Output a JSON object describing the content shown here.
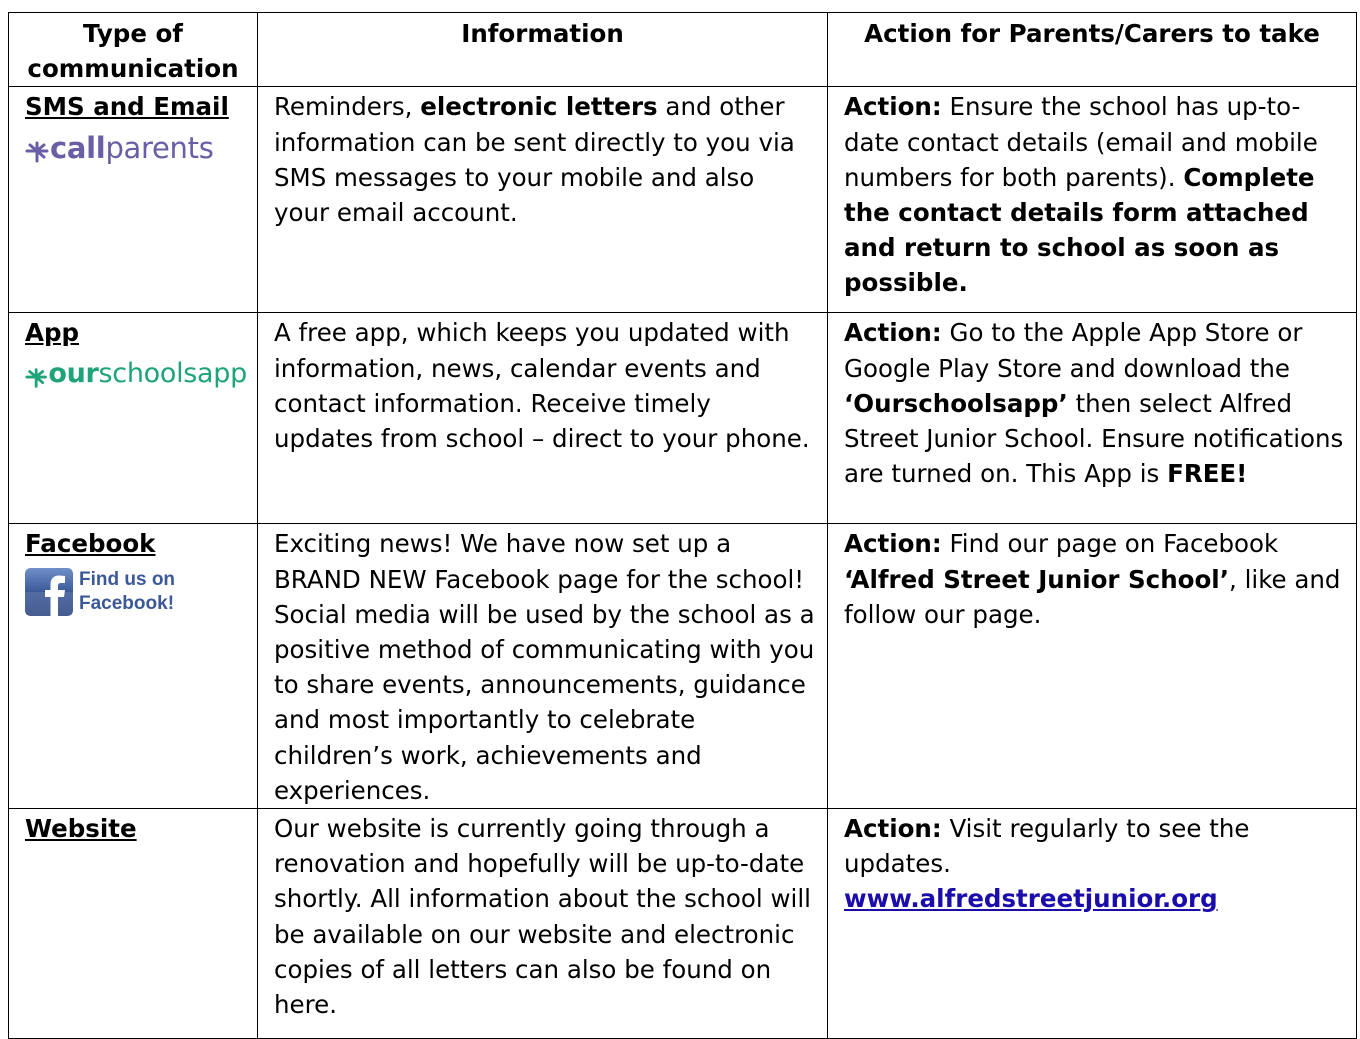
{
  "headers": {
    "type": "Type of communication",
    "info": "Information",
    "action": "Action for Parents/Carers to take"
  },
  "rows": [
    {
      "type": "SMS and Email",
      "logo_text_bold": "call",
      "logo_text": "parents",
      "info": [
        {
          "t": "Reminders, "
        },
        {
          "t": "electronic letters",
          "b": true
        },
        {
          "t": " and other information can be sent directly to you via SMS messages to your mobile and also your email account."
        }
      ],
      "action": [
        {
          "t": "Action:",
          "b": true
        },
        {
          "t": " Ensure the school has up-to-date contact details (email and mobile numbers for both parents). "
        },
        {
          "t": "Complete the contact details form attached and return to school as soon as possible.",
          "b": true
        }
      ]
    },
    {
      "type": "App",
      "logo_text_bold": "our",
      "logo_text": "schoolsapp",
      "info": [
        {
          "t": "A free app, which keeps you updated with information, news, calendar events and contact information. Receive timely updates from school – direct to your phone."
        }
      ],
      "action": [
        {
          "t": "Action:",
          "b": true
        },
        {
          "t": " Go to the Apple App Store or Google Play Store and download the "
        },
        {
          "t": "‘Ourschoolsapp’",
          "b": true
        },
        {
          "t": " then select Alfred Street Junior School. Ensure notifications are turned on. This App is "
        },
        {
          "t": "FREE!",
          "b": true
        }
      ]
    },
    {
      "type": "Facebook",
      "badge_line1": "Find us on",
      "badge_line2": "Facebook!",
      "info": [
        {
          "t": "Exciting news! We have now set up a BRAND NEW Facebook page for the school! Social media will be used by the school as a positive method of communicating with you to share events, announcements, guidance and most importantly to celebrate children’s work, achievements and experiences."
        }
      ],
      "action": [
        {
          "t": "Action:",
          "b": true
        },
        {
          "t": " Find our page on Facebook "
        },
        {
          "t": "‘Alfred Street Junior School’",
          "b": true
        },
        {
          "t": ", like and follow our page."
        }
      ]
    },
    {
      "type": "Website",
      "info": [
        {
          "t": "Our website is currently going through a renovation and hopefully will be up-to-date shortly. All information about the school will be available on our website and electronic copies of all letters can also be found on here."
        }
      ],
      "action_lead": "Action:",
      "action_text": " Visit regularly to see the updates.",
      "link": "www.alfredstreetjunior.org"
    }
  ],
  "colors": {
    "callparents": "#6a5fa6",
    "ourschoolsapp": "#1fa37a",
    "facebook": "#3b5998",
    "link": "#1a0dab"
  }
}
